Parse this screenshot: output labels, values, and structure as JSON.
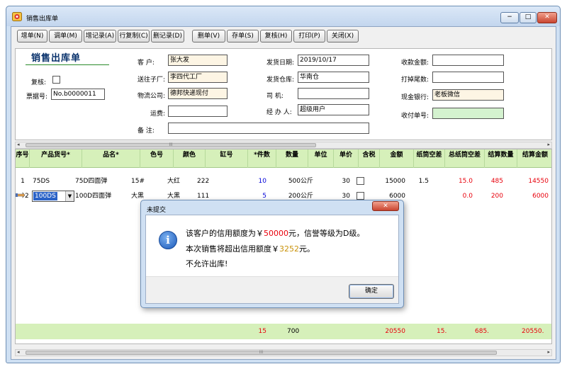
{
  "window": {
    "title": "销售出库单",
    "min": "−",
    "max": "□",
    "close": "✕"
  },
  "toolbar": [
    "增单(N)",
    "调单(M)",
    "增记录(A)",
    "行复制(C)",
    "删记录(D)",
    "删单(V)",
    "存单(S)",
    "复核(H)",
    "打印(P)",
    "关闭(X)"
  ],
  "form": {
    "title": "销售出库单",
    "review_label": "复核:",
    "ticket_label": "票据号:",
    "ticket_value": "No.b0000011",
    "customer_label": "客  户:",
    "customer_value": "张大发",
    "ship_to_label": "送往子厂:",
    "ship_to_value": "李四代工厂",
    "logistics_label": "物流公司:",
    "logistics_value": "德邦快递现付",
    "freight_label": "运费:",
    "freight_value": "",
    "remark_label": "备  注:",
    "remark_value": "",
    "ship_date_label": "发货日期:",
    "ship_date_value": "2019/10/17",
    "warehouse_label": "发货仓库:",
    "warehouse_value": "华南仓",
    "driver_label": "司  机:",
    "driver_value": "",
    "handler_label": "经 办 人:",
    "handler_value": "超级用户",
    "received_label": "收款金额:",
    "received_value": "",
    "rounding_label": "打掉尾数:",
    "rounding_value": "",
    "bank_label": "现金银行:",
    "bank_value": "老板微信",
    "voucher_label": "收付单号:",
    "voucher_value": ""
  },
  "scrollbar": {
    "left": "◂",
    "right": "▸",
    "grip": "III"
  },
  "grid": {
    "headers": [
      "序号",
      "产品货号*",
      "品名*",
      "色号",
      "颜色",
      "缸号",
      "*件数",
      "数量",
      "单位",
      "单价",
      "含税",
      "金额",
      "纸筒空差",
      "总纸筒空差",
      "结算数量",
      "结算金额"
    ],
    "rows": [
      {
        "no": "1",
        "code": "75DS",
        "name": "75D四面弹",
        "color_no": "15#",
        "color": "大红",
        "vat": "222",
        "pieces": "10",
        "qty": "500",
        "unit": "公斤",
        "price": "30",
        "amount": "15000",
        "tube": "1.5",
        "total_tube": "15.0",
        "settle_qty": "485",
        "settle_amount": "14550"
      },
      {
        "no": "2",
        "code": "100DS",
        "name": "100D四面弹",
        "color_no": "大黑",
        "color": "大黑",
        "vat": "111",
        "pieces": "5",
        "qty": "200",
        "unit": "公斤",
        "price": "30",
        "amount": "6000",
        "tube": "",
        "total_tube": "0.0",
        "settle_qty": "200",
        "settle_amount": "6000"
      }
    ],
    "totals": {
      "pieces": "15",
      "qty": "700",
      "amount": "20550",
      "total_tube": "15.",
      "settle_qty": "685.",
      "settle_amount": "20550."
    }
  },
  "dialog": {
    "title": "未提交",
    "close": "✕",
    "icon": "i",
    "line1_a": "该客户的信用额度为￥",
    "line1_b": "50000",
    "line1_c": "元，信誉等级为D级。",
    "line2_a": "本次销售将超出信用额度￥",
    "line2_b": "3252",
    "line2_c": "元。",
    "line3": "不允许出库!",
    "ok": "确定"
  }
}
